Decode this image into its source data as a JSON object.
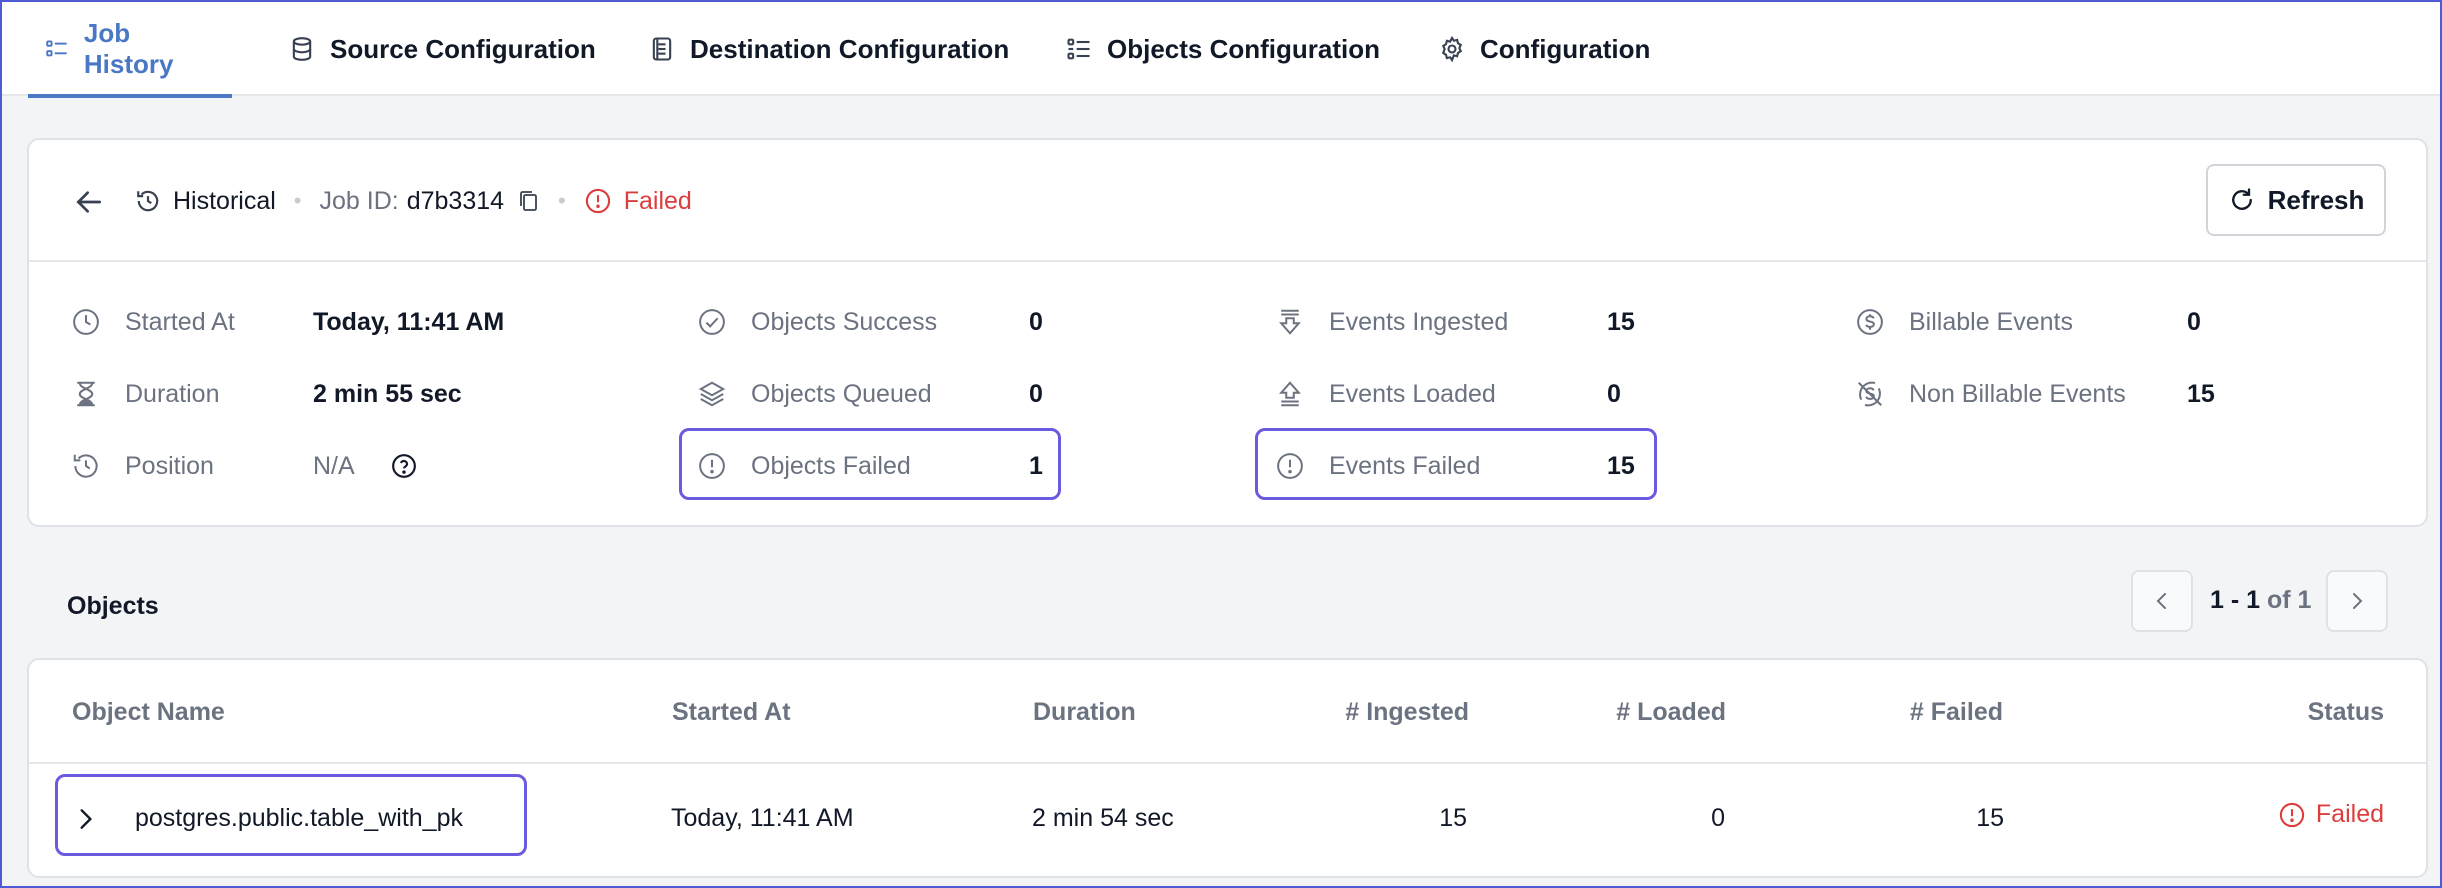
{
  "tabs": [
    {
      "label": "Job History",
      "icon": "list-icon",
      "active": true
    },
    {
      "label": "Source Configuration",
      "icon": "database-icon"
    },
    {
      "label": "Destination Configuration",
      "icon": "clipboard-icon"
    },
    {
      "label": "Objects Configuration",
      "icon": "list-icon"
    },
    {
      "label": "Configuration",
      "icon": "gear-icon"
    }
  ],
  "job": {
    "mode": "Historical",
    "job_id_label": "Job ID:",
    "job_id": "d7b3314",
    "status": "Failed",
    "refresh_label": "Refresh"
  },
  "stats": {
    "started_at": {
      "label": "Started At",
      "value": "Today, 11:41 AM"
    },
    "duration": {
      "label": "Duration",
      "value": "2 min 55 sec"
    },
    "position": {
      "label": "Position",
      "value": "N/A"
    },
    "objects_success": {
      "label": "Objects Success",
      "value": "0"
    },
    "objects_queued": {
      "label": "Objects Queued",
      "value": "0"
    },
    "objects_failed": {
      "label": "Objects Failed",
      "value": "1"
    },
    "events_ingested": {
      "label": "Events Ingested",
      "value": "15"
    },
    "events_loaded": {
      "label": "Events Loaded",
      "value": "0"
    },
    "events_failed": {
      "label": "Events Failed",
      "value": "15"
    },
    "billable_events": {
      "label": "Billable Events",
      "value": "0"
    },
    "non_billable_events": {
      "label": "Non Billable Events",
      "value": "15"
    }
  },
  "objects": {
    "title": "Objects",
    "pager": {
      "range": "1 - 1",
      "of_label": "of 1"
    },
    "columns": [
      "Object Name",
      "Started At",
      "Duration",
      "# Ingested",
      "# Loaded",
      "# Failed",
      "Status"
    ],
    "rows": [
      {
        "name": "postgres.public.table_with_pk",
        "started_at": "Today, 11:41 AM",
        "duration": "2 min 54 sec",
        "ingested": "15",
        "loaded": "0",
        "failed": "15",
        "status": "Failed"
      }
    ]
  },
  "colors": {
    "accent": "#4a78c4",
    "error": "#dc3d3d",
    "highlight": "#6a5ae0"
  }
}
